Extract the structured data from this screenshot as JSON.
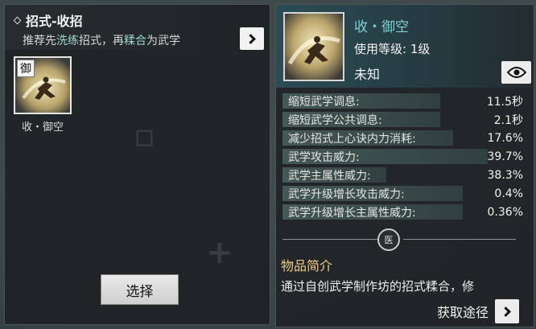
{
  "left_panel": {
    "title": "招式-收招",
    "subtitle_prefix": "推荐先",
    "subtitle_hl1": "洗练",
    "subtitle_mid": "招式，再",
    "subtitle_hl2": "糅合",
    "subtitle_suffix": "为武学",
    "slot": {
      "badge": "御",
      "name": "收・御空"
    },
    "select_label": "选择"
  },
  "right_panel": {
    "name": "收・御空",
    "level": "使用等级: 1级",
    "state": "未知",
    "stats": [
      {
        "label": "缩短武学调息:",
        "value": "11.5秒",
        "fill": 0.64
      },
      {
        "label": "缩短武学公共调息:",
        "value": "2.1秒",
        "fill": 0.64
      },
      {
        "label": "减少招式上心诀内力消耗:",
        "value": "17.6%",
        "fill": 0.69
      },
      {
        "label": "武学攻击威力:",
        "value": "39.7%",
        "fill": 0.83
      },
      {
        "label": "武学主属性威力:",
        "value": "38.3%",
        "fill": 0.42
      },
      {
        "label": "武学升级增长攻击威力:",
        "value": "0.4%",
        "fill": 0.73
      },
      {
        "label": "武学升级增长主属性威力:",
        "value": "0.36%",
        "fill": 0.73
      }
    ],
    "medal_glyph": "医",
    "desc_title": "物品简介",
    "desc_text": "通过自创武学制作坊的招式糅合，修",
    "acquire_label": "获取途径"
  },
  "icons": {
    "diamond": "diamond-icon",
    "chevron": "chevron-right-icon",
    "eye": "eye-icon"
  },
  "colors": {
    "name_accent": "#7fd0d6",
    "highlight": "#9fd7c9",
    "desc_title": "#f2c98a"
  }
}
